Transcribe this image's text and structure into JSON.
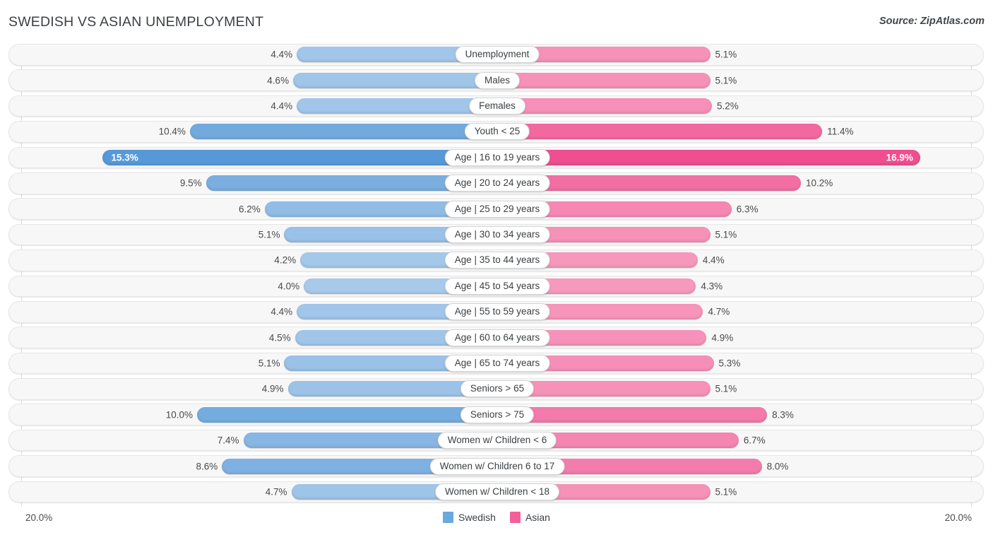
{
  "header": {
    "title": "SWEDISH VS ASIAN UNEMPLOYMENT",
    "source": "Source: ZipAtlas.com"
  },
  "legend": {
    "items": [
      {
        "label": "Swedish",
        "color": "#6aa9dd"
      },
      {
        "label": "Asian",
        "color": "#f2619b"
      }
    ]
  },
  "axis": {
    "left_label": "20.0%",
    "right_label": "20.0%",
    "max": 20.0
  },
  "chart_data": {
    "type": "bar",
    "orientation": "horizontal-diverging",
    "title": "SWEDISH VS ASIAN UNEMPLOYMENT",
    "xlabel": "",
    "ylabel": "",
    "xlim": [
      0,
      20.0
    ],
    "grid": true,
    "legend_position": "bottom-center",
    "unit": "%",
    "categories": [
      "Unemployment",
      "Males",
      "Females",
      "Youth < 25",
      "Age | 16 to 19 years",
      "Age | 20 to 24 years",
      "Age | 25 to 29 years",
      "Age | 30 to 34 years",
      "Age | 35 to 44 years",
      "Age | 45 to 54 years",
      "Age | 55 to 59 years",
      "Age | 60 to 64 years",
      "Age | 65 to 74 years",
      "Seniors > 65",
      "Seniors > 75",
      "Women w/ Children < 6",
      "Women w/ Children 6 to 17",
      "Women w/ Children < 18"
    ],
    "series": [
      {
        "name": "Swedish",
        "color": "#6aa9dd",
        "values": [
          4.4,
          4.6,
          4.4,
          10.4,
          15.3,
          9.5,
          6.2,
          5.1,
          4.2,
          4.0,
          4.4,
          4.5,
          5.1,
          4.9,
          10.0,
          7.4,
          8.6,
          4.7
        ]
      },
      {
        "name": "Asian",
        "color": "#f2619b",
        "values": [
          5.1,
          5.1,
          5.2,
          11.4,
          16.9,
          10.2,
          6.3,
          5.1,
          4.4,
          4.3,
          4.7,
          4.9,
          5.3,
          5.1,
          8.3,
          6.7,
          8.0,
          5.1
        ]
      }
    ]
  },
  "rows": [
    {
      "label": "Unemployment",
      "left_value": "4.4%",
      "right_value": "5.1%",
      "left_num": 4.4,
      "right_num": 5.1
    },
    {
      "label": "Males",
      "left_value": "4.6%",
      "right_value": "5.1%",
      "left_num": 4.6,
      "right_num": 5.1
    },
    {
      "label": "Females",
      "left_value": "4.4%",
      "right_value": "5.2%",
      "left_num": 4.4,
      "right_num": 5.2
    },
    {
      "label": "Youth < 25",
      "left_value": "10.4%",
      "right_value": "11.4%",
      "left_num": 10.4,
      "right_num": 11.4
    },
    {
      "label": "Age | 16 to 19 years",
      "left_value": "15.3%",
      "right_value": "16.9%",
      "left_num": 15.3,
      "right_num": 16.9
    },
    {
      "label": "Age | 20 to 24 years",
      "left_value": "9.5%",
      "right_value": "10.2%",
      "left_num": 9.5,
      "right_num": 10.2
    },
    {
      "label": "Age | 25 to 29 years",
      "left_value": "6.2%",
      "right_value": "6.3%",
      "left_num": 6.2,
      "right_num": 6.3
    },
    {
      "label": "Age | 30 to 34 years",
      "left_value": "5.1%",
      "right_value": "5.1%",
      "left_num": 5.1,
      "right_num": 5.1
    },
    {
      "label": "Age | 35 to 44 years",
      "left_value": "4.2%",
      "right_value": "4.4%",
      "left_num": 4.2,
      "right_num": 4.4
    },
    {
      "label": "Age | 45 to 54 years",
      "left_value": "4.0%",
      "right_value": "4.3%",
      "left_num": 4.0,
      "right_num": 4.3
    },
    {
      "label": "Age | 55 to 59 years",
      "left_value": "4.4%",
      "right_value": "4.7%",
      "left_num": 4.4,
      "right_num": 4.7
    },
    {
      "label": "Age | 60 to 64 years",
      "left_value": "4.5%",
      "right_value": "4.9%",
      "left_num": 4.5,
      "right_num": 4.9
    },
    {
      "label": "Age | 65 to 74 years",
      "left_value": "5.1%",
      "right_value": "5.3%",
      "left_num": 5.1,
      "right_num": 5.3
    },
    {
      "label": "Seniors > 65",
      "left_value": "4.9%",
      "right_value": "5.1%",
      "left_num": 4.9,
      "right_num": 5.1
    },
    {
      "label": "Seniors > 75",
      "left_value": "10.0%",
      "right_value": "8.3%",
      "left_num": 10.0,
      "right_num": 8.3
    },
    {
      "label": "Women w/ Children < 6",
      "left_value": "7.4%",
      "right_value": "6.7%",
      "left_num": 7.4,
      "right_num": 6.7
    },
    {
      "label": "Women w/ Children 6 to 17",
      "left_value": "8.6%",
      "right_value": "8.0%",
      "left_num": 8.6,
      "right_num": 8.0
    },
    {
      "label": "Women w/ Children < 18",
      "left_value": "4.7%",
      "right_value": "5.1%",
      "left_num": 4.7,
      "right_num": 5.1
    }
  ]
}
